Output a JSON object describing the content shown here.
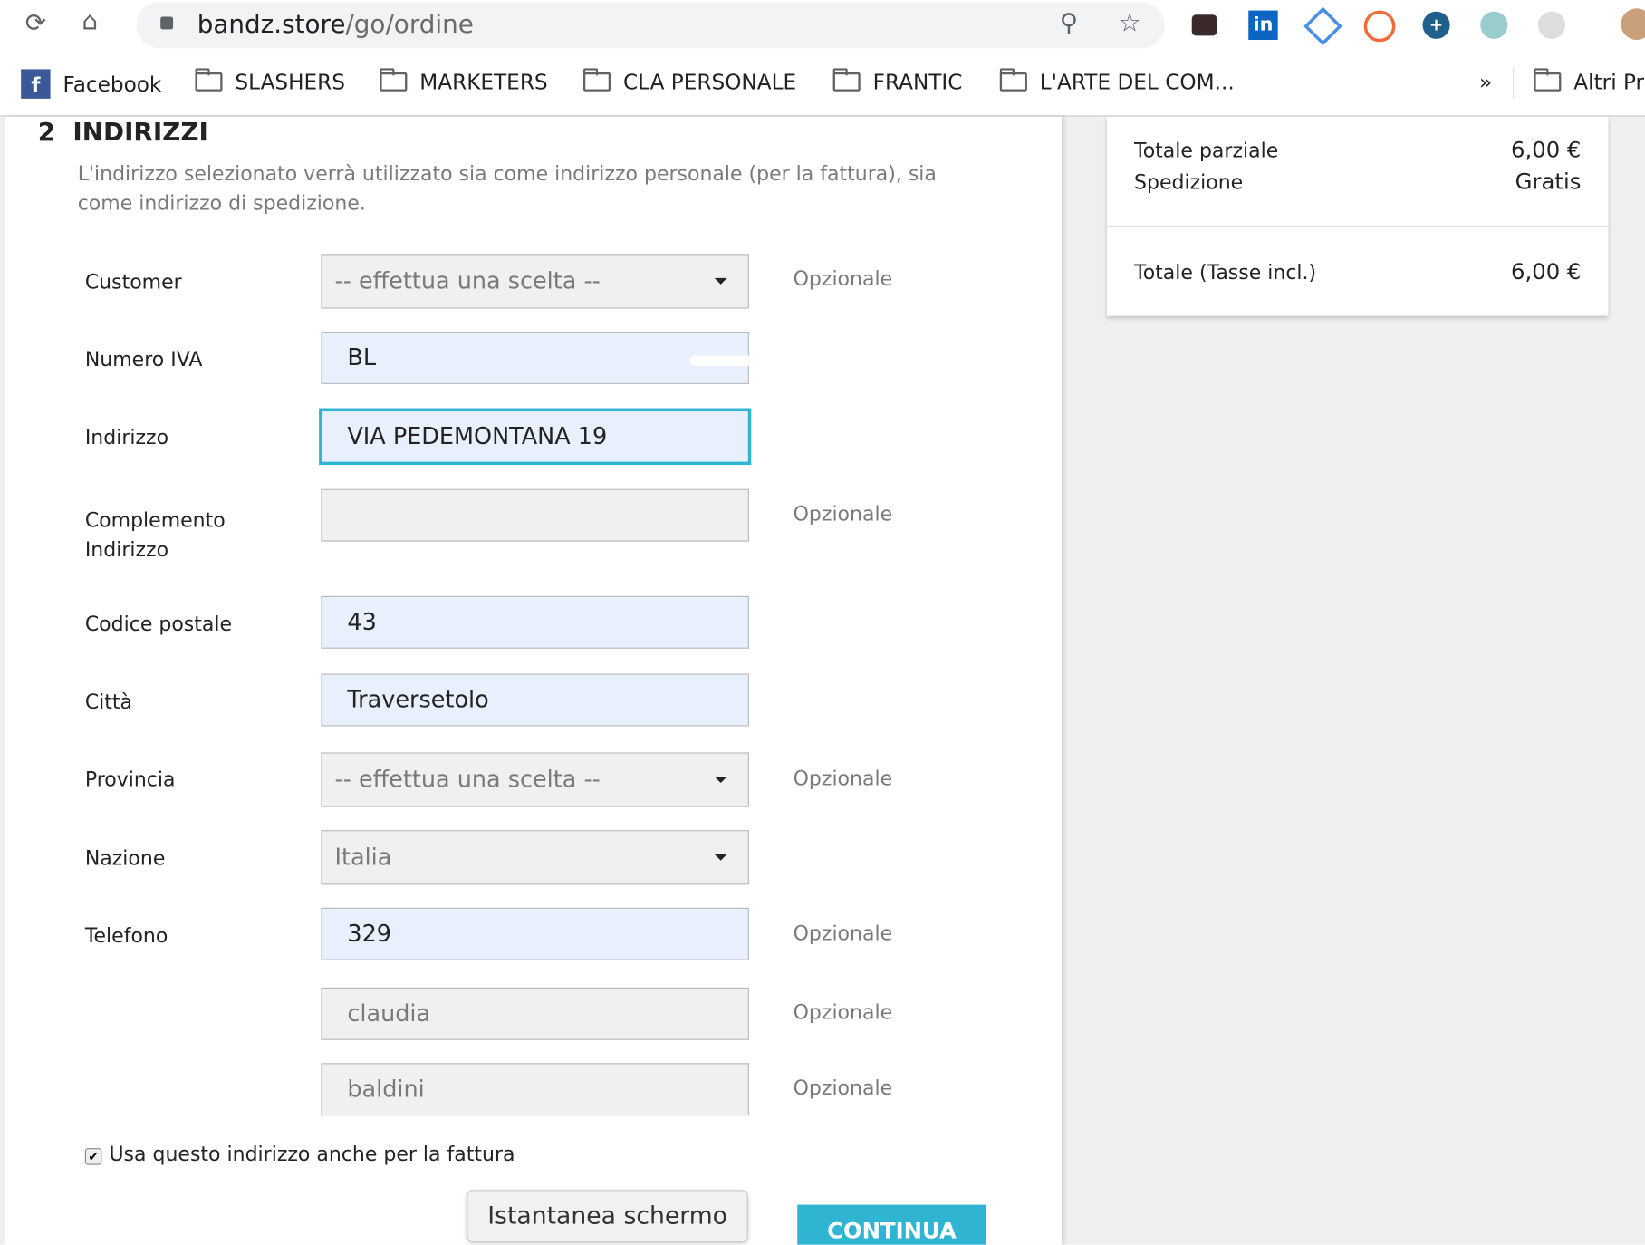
{
  "browser": {
    "url_host": "bandz.store",
    "url_path": "/go/ordine",
    "bookmarks": [
      "Facebook",
      "SLASHERS",
      "MARKETERS",
      "CLA PERSONALE",
      "FRANTIC",
      "L'ARTE DEL COM...",
      "Altri Pr"
    ],
    "overflow": "»"
  },
  "section": {
    "number": "2",
    "title": "INDIRIZZI",
    "description": "L'indirizzo selezionato verrà utilizzato sia come indirizzo personale (per la fattura), sia come indirizzo di spedizione."
  },
  "form": {
    "optional": "Opzionale",
    "customer": {
      "label": "Customer",
      "value": "-- effettua una scelta --"
    },
    "vat": {
      "label": "Numero IVA",
      "value": "BL"
    },
    "address": {
      "label": "Indirizzo",
      "value": "VIA PEDEMONTANA 19"
    },
    "address2": {
      "label": "Complemento Indirizzo",
      "value": ""
    },
    "postcode": {
      "label": "Codice postale",
      "value": "43"
    },
    "city": {
      "label": "Città",
      "value": "Traversetolo"
    },
    "state": {
      "label": "Provincia",
      "value": "-- effettua una scelta --"
    },
    "country": {
      "label": "Nazione",
      "value": "Italia"
    },
    "phone": {
      "label": "Telefono",
      "value": "329"
    },
    "firstname": {
      "value": "claudia"
    },
    "lastname": {
      "value": "baldini"
    },
    "use_for_invoice": "Usa questo indirizzo anche per la fattura",
    "continue": "CONTINUA"
  },
  "tooltip": "Istantanea schermo",
  "summary": {
    "subtotal_label": "Totale parziale",
    "subtotal": "6,00 €",
    "shipping_label": "Spedizione",
    "shipping": "Gratis",
    "total_label": "Totale (Tasse incl.)",
    "total": "6,00 €"
  },
  "colors": {
    "accent": "#2fb5d2",
    "autofill": "#e8f0fe"
  }
}
